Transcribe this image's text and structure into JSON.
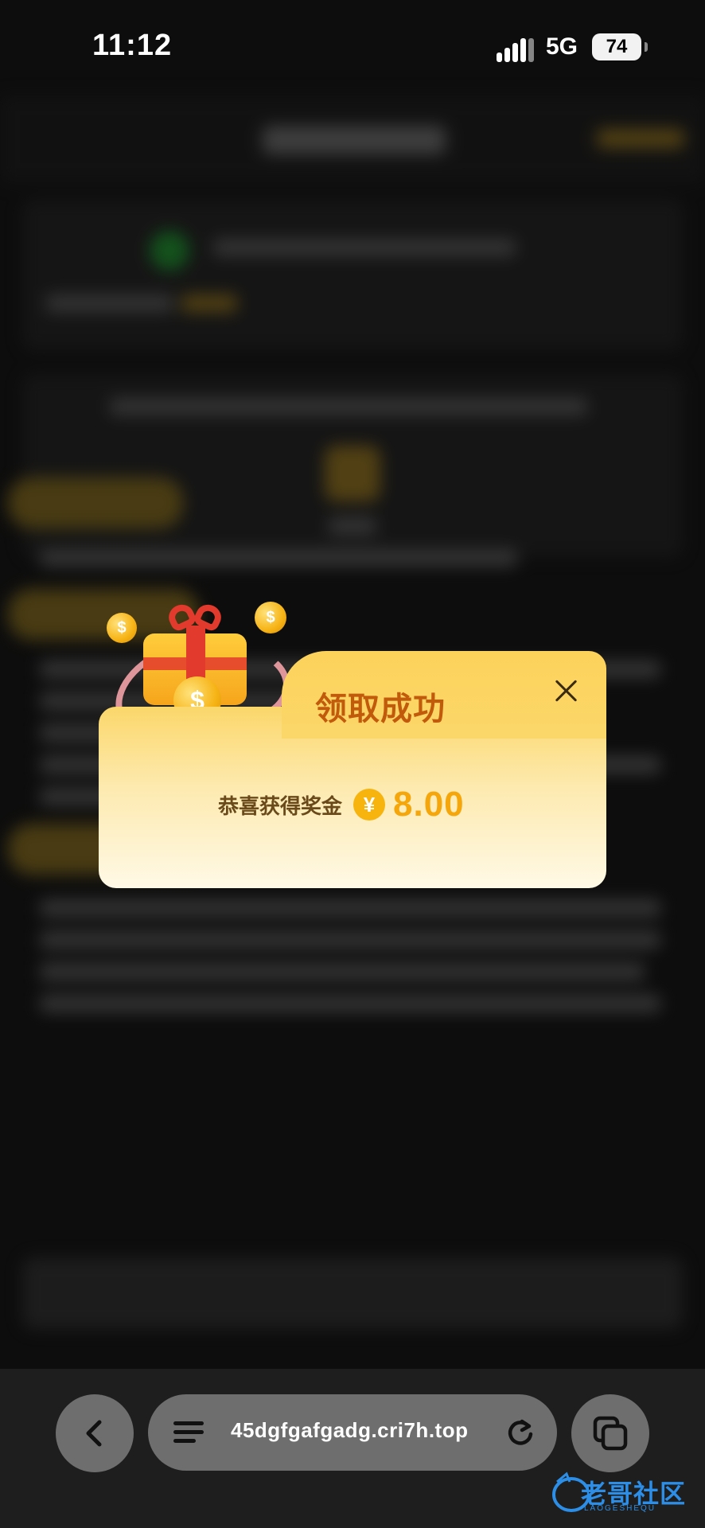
{
  "status_bar": {
    "time": "11:12",
    "network": "5G",
    "battery": "74"
  },
  "dialog": {
    "title": "领取成功",
    "prize_label": "恭喜获得奖金",
    "currency_symbol": "¥",
    "amount": "8.00",
    "close_icon": "close-icon"
  },
  "browser": {
    "url": "45dgfgafgadg.cri7h.top",
    "back_icon": "chevron-left-icon",
    "menu_icon": "menu-icon",
    "reload_icon": "reload-icon",
    "tabs_icon": "tabs-icon"
  },
  "watermark": {
    "main": "老哥社区",
    "sub": "LAOGESHEQU"
  },
  "colors": {
    "accent_gold": "#f5a60a",
    "title_orange": "#c25a0c",
    "background": "#0d0d0d"
  }
}
